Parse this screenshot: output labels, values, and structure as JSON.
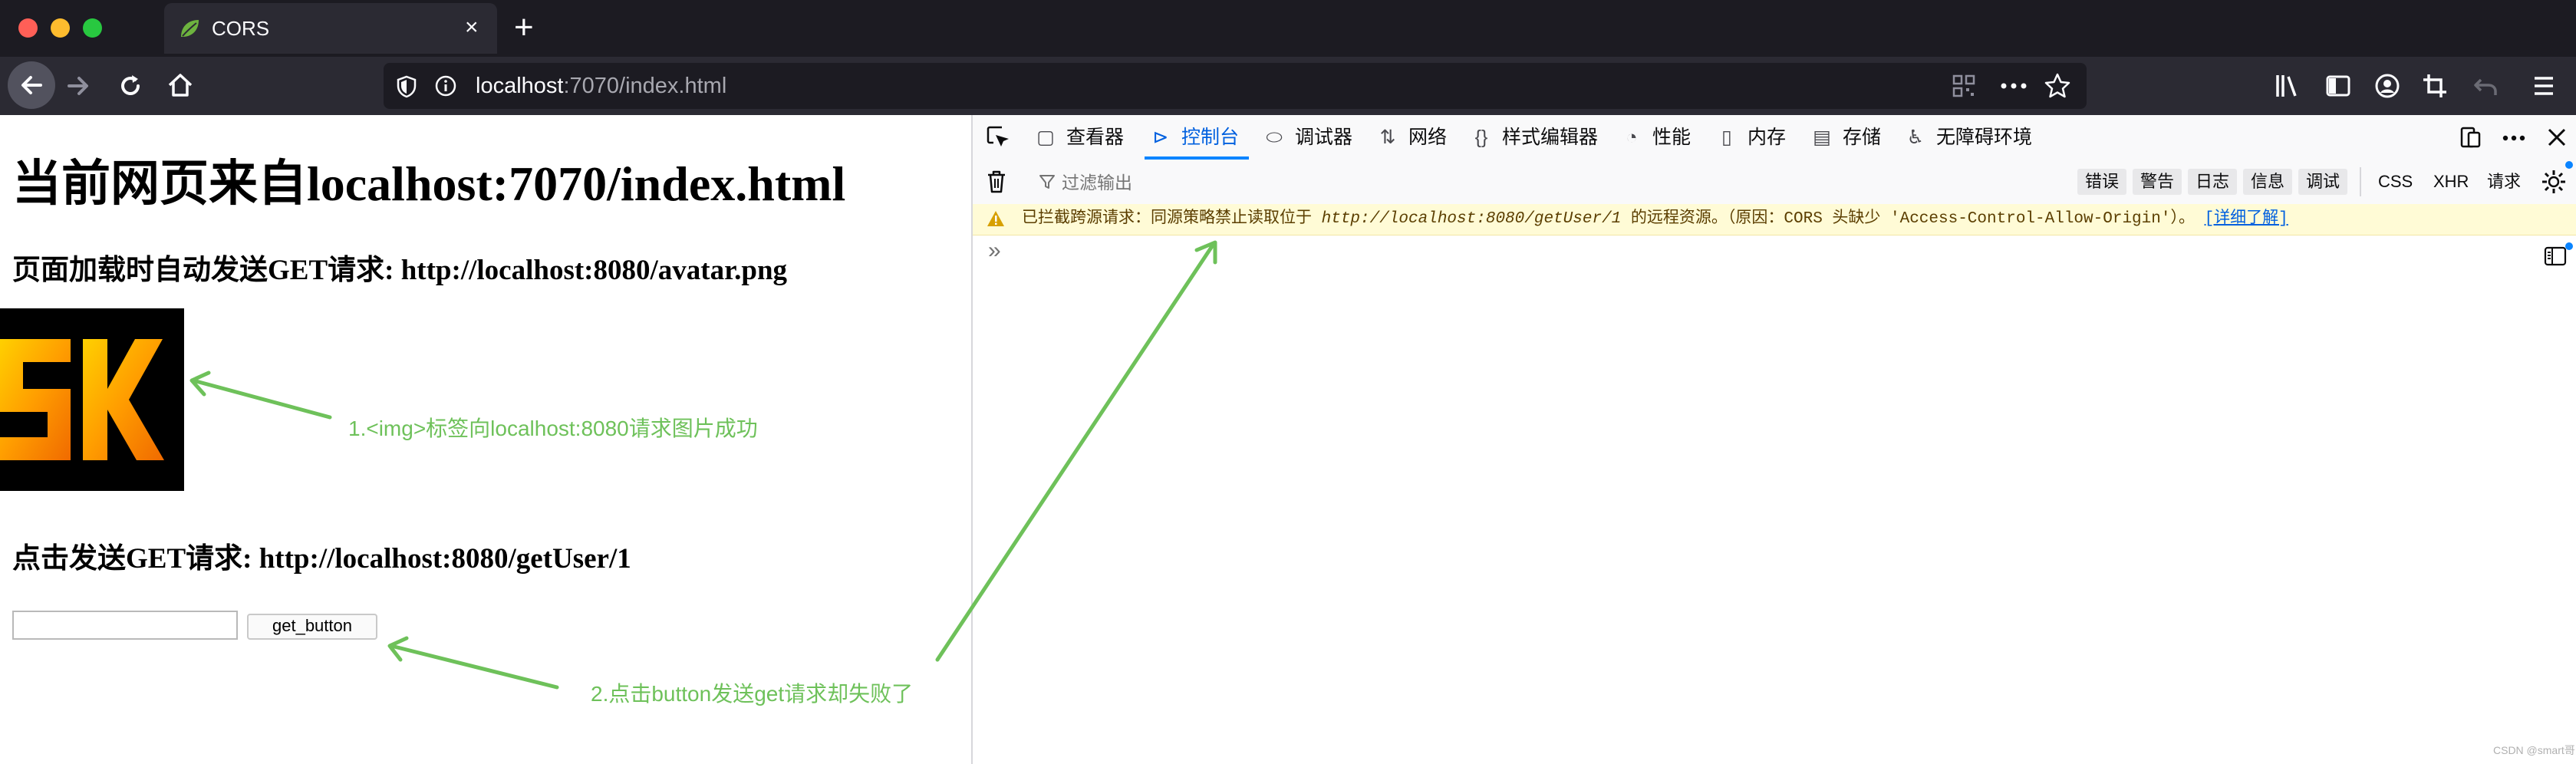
{
  "window": {
    "tab_title": "CORS",
    "tab_close": "×",
    "new_tab": "+"
  },
  "toolbar": {
    "url_host": "localhost",
    "url_path": ":7070/index.html"
  },
  "page": {
    "h1": "当前网页来自localhost:7070/index.html",
    "h3_img": "页面加载时自动发送GET请求: http://localhost:8080/avatar.png",
    "h3_btn": "点击发送GET请求: http://localhost:8080/getUser/1",
    "input_value": "",
    "button_label": "get_button",
    "annotation_1": "1.<img>标签向localhost:8080请求图片成功",
    "annotation_2": "2.点击button发送get请求却失败了",
    "colors": {
      "annotation": "#6ec15a"
    }
  },
  "devtools": {
    "tabs": [
      {
        "label": "查看器",
        "icon": "inspector-icon"
      },
      {
        "label": "控制台",
        "icon": "console-icon",
        "active": true
      },
      {
        "label": "调试器",
        "icon": "debugger-icon"
      },
      {
        "label": "网络",
        "icon": "network-icon"
      },
      {
        "label": "样式编辑器",
        "icon": "style-editor-icon"
      },
      {
        "label": "性能",
        "icon": "performance-icon"
      },
      {
        "label": "内存",
        "icon": "memory-icon"
      },
      {
        "label": "存储",
        "icon": "storage-icon"
      },
      {
        "label": "无障碍环境",
        "icon": "accessibility-icon"
      }
    ],
    "filter_placeholder": "过滤输出",
    "levels": [
      "错误",
      "警告",
      "日志",
      "信息",
      "调试"
    ],
    "requests": [
      "CSS",
      "XHR",
      "请求"
    ],
    "warning": {
      "prefix": "已拦截跨源请求：同源策略禁止读取位于 ",
      "url": "http://localhost:8080/getUser/1",
      "suffix": " 的远程资源。（原因：CORS 头缺少 'Access-Control-Allow-Origin'）。",
      "link": "[详细了解]"
    },
    "prompt": "»",
    "colors": {
      "active": "#0060df",
      "warning_bg": "#fffbd6"
    }
  },
  "watermark": "CSDN @smart哥"
}
